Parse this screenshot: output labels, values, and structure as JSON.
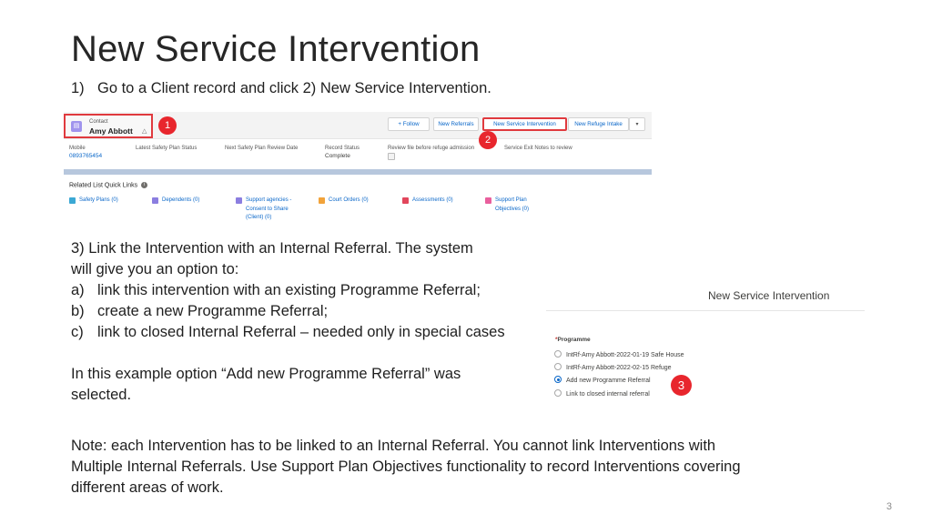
{
  "slide": {
    "title": "New Service Intervention",
    "step1_num": "1)",
    "step1_text": "Go to a Client record and click 2) New Service Intervention.",
    "page_number": "3"
  },
  "record": {
    "object_label": "Contact",
    "contact_name": "Amy Abbott",
    "contact_icon": "contact-card-icon",
    "buttons": {
      "follow": "+ Follow",
      "new_referrals": "New Referrals",
      "new_service_intervention": "New Service Intervention",
      "new_refuge_intake": "New Refuge Intake",
      "more": "▾"
    },
    "fields": [
      {
        "label": "Mobile",
        "value": "0893765454"
      },
      {
        "label": "Latest Safety Plan Status",
        "value": ""
      },
      {
        "label": "Next Safety Plan Review Date",
        "value": ""
      },
      {
        "label": "Record Status",
        "value": "Complete"
      },
      {
        "label": "Review file before refuge admission",
        "value": ""
      },
      {
        "label": "Service Exit Notes to review",
        "value": ""
      }
    ],
    "related_title": "Related List Quick Links",
    "related_links": [
      {
        "line1": "Safety Plans (0)",
        "line2": "",
        "line3": "",
        "color": "#3ba8d4"
      },
      {
        "line1": "Dependents (0)",
        "line2": "",
        "line3": "",
        "color": "#8b7ee0"
      },
      {
        "line1": "Support agencies -",
        "line2": "Consent to Share",
        "line3": "(Client) (0)",
        "color": "#8b7ee0"
      },
      {
        "line1": "Court Orders (0)",
        "line2": "",
        "line3": "",
        "color": "#f2a33a"
      },
      {
        "line1": "Assessments (0)",
        "line2": "",
        "line3": "",
        "color": "#e2465c"
      },
      {
        "line1": "Support Plan",
        "line2": "Objectives (0)",
        "line3": "",
        "color": "#e95f9d"
      }
    ]
  },
  "callouts": {
    "one": "1",
    "two": "2",
    "three": "3"
  },
  "step3": {
    "line1": "3) Link the Intervention with an Internal Referral.  The system",
    "line2": "will give you an option to:",
    "a_marker": "a)",
    "a_text": "link this intervention with an existing Programme Referral;",
    "b_marker": "b)",
    "b_text": "create a new Programme Referral;",
    "c_marker": "c)",
    "c_text": "link to closed Internal Referral – needed only in special cases",
    "example_line1": "In this example option “Add new Programme Referral” was",
    "example_line2": "selected."
  },
  "panel": {
    "title": "New Service Intervention",
    "field_label": "Programme",
    "required_mark": "*",
    "options": [
      {
        "label": "IntRf-Amy Abbott-2022-01-19 Safe House",
        "selected": false
      },
      {
        "label": "IntRf-Amy Abbott-2022-02-15 Refuge",
        "selected": false
      },
      {
        "label": "Add new Programme Referral",
        "selected": true
      },
      {
        "label": "Link to closed internal referral",
        "selected": false
      }
    ]
  },
  "note": {
    "line1": "Note: each Intervention has to be linked to an Internal Referral. You cannot link Interventions with",
    "line2": "Multiple Internal Referrals. Use Support Plan Objectives functionality to record Interventions covering",
    "line3": "different areas of work."
  }
}
